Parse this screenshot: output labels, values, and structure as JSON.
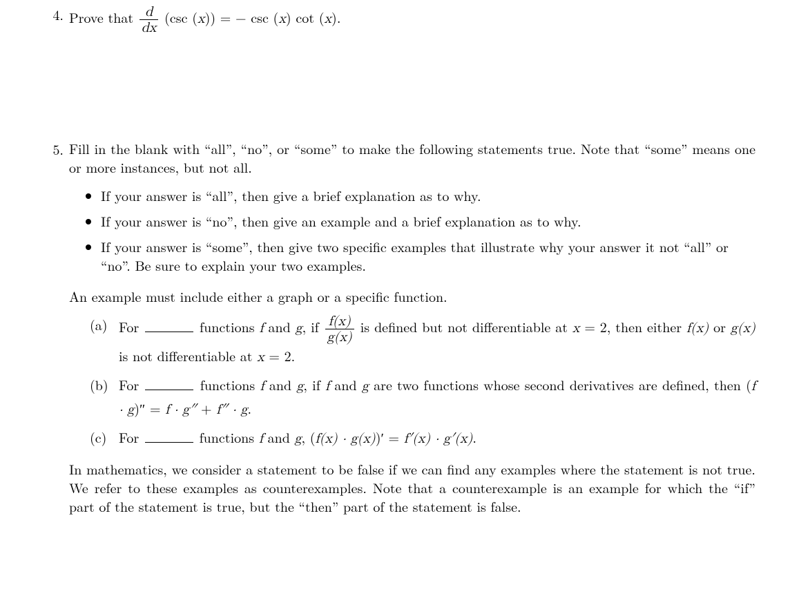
{
  "p4": {
    "num": "4.",
    "lead": "Prove that ",
    "frac_top": "d",
    "frac_bot": "dx",
    "expr_pre": "(csc (",
    "x": "x",
    "expr_mid1": ")) = − csc (",
    "expr_mid2": ") cot (",
    "expr_end": ").",
    "csc": "csc",
    "cot": "cot"
  },
  "p5": {
    "num": "5.",
    "intro": "Fill in the blank with “all”, “no”, or “some” to make the following statements true. Note that “some” means one or more instances, but not all.",
    "bullets": [
      "If your answer is “all”, then give a brief explanation as to why.",
      "If your answer is “no”, then give an example and a brief explanation as to why.",
      "If your answer is “some”, then give two specific examples that illustrate why your answer it not “all” or “no”. Be sure to explain your two examples."
    ],
    "example_note": "An example must include either a graph or a specific function.",
    "a": {
      "label": "(a)",
      "t1": "For ",
      "t2": " functions ",
      "fg": "f",
      "and": " and ",
      "g": "g",
      "t3": ", if ",
      "frac_top": "f(x)",
      "frac_bot": "g(x)",
      "t4": " is defined but not differentiable at ",
      "xeq": "x",
      "eq": " = 2, then either ",
      "fx": "f(x)",
      "or": " or ",
      "gx": "g(x)",
      "t5": " is not differentiable at ",
      "t6": " = 2."
    },
    "b": {
      "label": "(b)",
      "t1": "For ",
      "t2": " functions ",
      "f": "f",
      "and": " and ",
      "g": "g",
      "t3": ", if ",
      "t4": " are two functions whose second derivatives are defined, then (",
      "fdotg": "f · g",
      "t5": ")″ = ",
      "rhs1": "f · g″",
      "plus": " + ",
      "rhs2": "f″ · g",
      "t6": "."
    },
    "c": {
      "label": "(c)",
      "t1": "For ",
      "t2": " functions ",
      "f": "f",
      "and": " and ",
      "g": "g",
      "t3": ", (",
      "lhs": "f(x) · g(x)",
      "t4": ")′ = ",
      "rhs": "f′(x) · g′(x)",
      "t5": "."
    },
    "footnote": "In mathematics, we consider a statement to be false if we can find any examples where the statement is not true. We refer to these examples as counterexamples. Note that a counterexample is an example for which the “if” part of the statement is true, but the “then” part of the statement is false."
  }
}
